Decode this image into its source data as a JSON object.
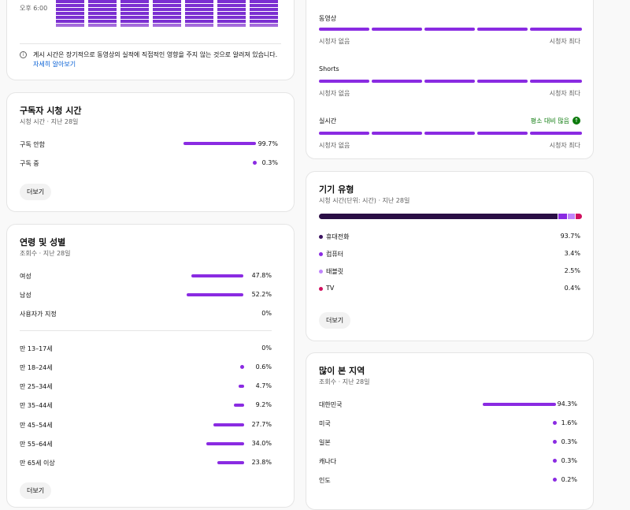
{
  "heatmap": {
    "time_label": "오후 6:00",
    "note": "게시 시간은 장기적으로 동영상의 실적에 직접적인 영향을 주지 않는 것으로 알려져 있습니다.",
    "note_link": "자세히 알아보기"
  },
  "viewer_types": {
    "rows": [
      {
        "label": "동영상",
        "left": "시청자 없음",
        "right": "시청자 최다"
      },
      {
        "label": "Shorts",
        "left": "시청자 없음",
        "right": "시청자 최다"
      },
      {
        "label": "실시간",
        "left": "시청자 없음",
        "right": "시청자 최다",
        "badge": "평소 대비 많음"
      }
    ]
  },
  "subscriber": {
    "title": "구독자 시청 시간",
    "subtitle": "시청 시간 · 지난 28일",
    "rows": [
      {
        "label": "구독 안함",
        "value": "99.7%",
        "pct": 99.7
      },
      {
        "label": "구독 중",
        "value": "0.3%",
        "pct": 0.3
      }
    ],
    "more": "더보기"
  },
  "age_gender": {
    "title": "연령 및 성별",
    "subtitle": "조회수 · 지난 28일",
    "gender": [
      {
        "label": "여성",
        "value": "47.8%",
        "pct": 47.8
      },
      {
        "label": "남성",
        "value": "52.2%",
        "pct": 52.2
      },
      {
        "label": "사용자가 지정",
        "value": "0%",
        "pct": 0
      }
    ],
    "ages": [
      {
        "label": "만 13–17세",
        "value": "0%",
        "pct": 0
      },
      {
        "label": "만 18–24세",
        "value": "0.6%",
        "pct": 0.6
      },
      {
        "label": "만 25–34세",
        "value": "4.7%",
        "pct": 4.7
      },
      {
        "label": "만 35–44세",
        "value": "9.2%",
        "pct": 9.2
      },
      {
        "label": "만 45–54세",
        "value": "27.7%",
        "pct": 27.7
      },
      {
        "label": "만 55–64세",
        "value": "34.0%",
        "pct": 34.0
      },
      {
        "label": "만 65세 이상",
        "value": "23.8%",
        "pct": 23.8
      }
    ],
    "more": "더보기"
  },
  "device": {
    "title": "기기 유형",
    "subtitle": "시청 시간(단위: 시간) · 지난 28일",
    "rows": [
      {
        "label": "휴대전화",
        "value": "93.7%",
        "pct": 93.7,
        "color": "#3b1361"
      },
      {
        "label": "컴퓨터",
        "value": "3.4%",
        "pct": 3.4,
        "color": "#8a2be2"
      },
      {
        "label": "태블릿",
        "value": "2.5%",
        "pct": 2.5,
        "color": "#c084fc"
      },
      {
        "label": "TV",
        "value": "0.4%",
        "pct": 0.4,
        "color": "#d0105f"
      }
    ],
    "more": "더보기"
  },
  "geo": {
    "title": "많이 본 지역",
    "subtitle": "조회수 · 지난 28일",
    "rows": [
      {
        "label": "대한민국",
        "value": "94.3%",
        "pct": 94.3
      },
      {
        "label": "미국",
        "value": "1.6%",
        "pct": 1.6
      },
      {
        "label": "일본",
        "value": "0.3%",
        "pct": 0.3
      },
      {
        "label": "캐나다",
        "value": "0.3%",
        "pct": 0.3
      },
      {
        "label": "인도",
        "value": "0.2%",
        "pct": 0.2
      }
    ]
  }
}
